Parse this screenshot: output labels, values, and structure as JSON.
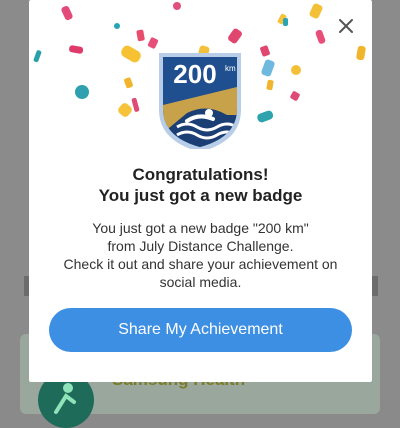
{
  "background_app": {
    "card_title": "Samsung Health"
  },
  "dialog": {
    "badge": {
      "distance_number": "200",
      "distance_unit": "km"
    },
    "title_line1": "Congratulations!",
    "title_line2": "You just got a new badge",
    "body_line1": "You just got a new badge \"200 km\"",
    "body_line2": "from July Distance Challenge.",
    "body_line3": "Check it out and share your achievement on",
    "body_line4": "social media.",
    "share_button_label": "Share My Achievement",
    "close_icon": "close-icon"
  },
  "colors": {
    "primary_button": "#3d8fe3",
    "badge_blue": "#1f4f8f",
    "badge_gold": "#c7a24a"
  }
}
